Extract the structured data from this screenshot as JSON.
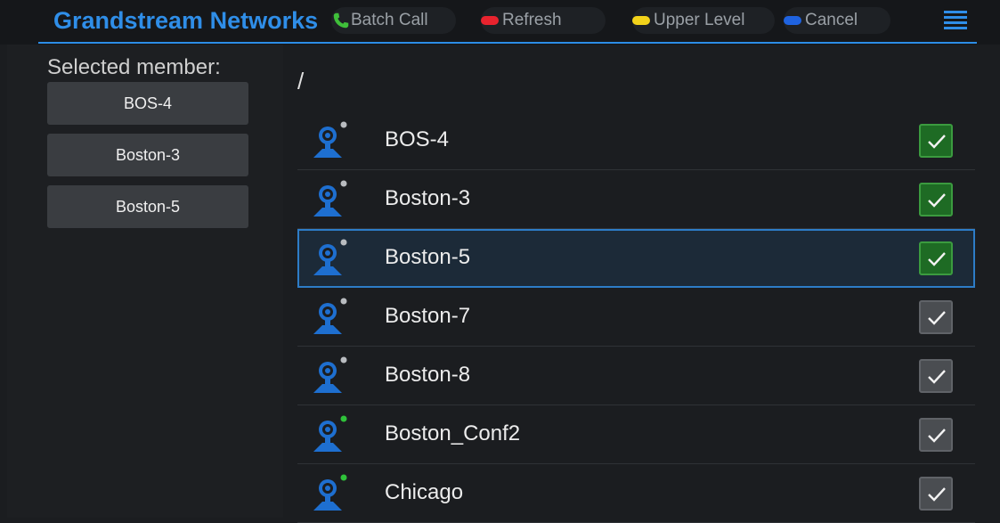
{
  "header": {
    "brand": "Grandstream Networks",
    "batch_call": "Batch Call",
    "refresh": "Refresh",
    "upper_level": "Upper Level",
    "cancel": "Cancel",
    "colors": {
      "red": "#e8232e",
      "yellow": "#f2d21a",
      "blue": "#1f63e0",
      "accent": "#2c8de6"
    }
  },
  "left": {
    "label": "Selected member:",
    "members": [
      "BOS-4",
      "Boston-3",
      "Boston-5"
    ]
  },
  "main": {
    "path": "/",
    "rows": [
      {
        "name": "BOS-4",
        "checked": true,
        "status": "gray",
        "selected": false
      },
      {
        "name": "Boston-3",
        "checked": true,
        "status": "gray",
        "selected": false
      },
      {
        "name": "Boston-5",
        "checked": true,
        "status": "gray",
        "selected": true
      },
      {
        "name": "Boston-7",
        "checked": false,
        "status": "gray",
        "selected": false
      },
      {
        "name": "Boston-8",
        "checked": false,
        "status": "gray",
        "selected": false
      },
      {
        "name": "Boston_Conf2",
        "checked": false,
        "status": "green",
        "selected": false
      },
      {
        "name": "Chicago",
        "checked": false,
        "status": "green",
        "selected": false
      }
    ]
  }
}
